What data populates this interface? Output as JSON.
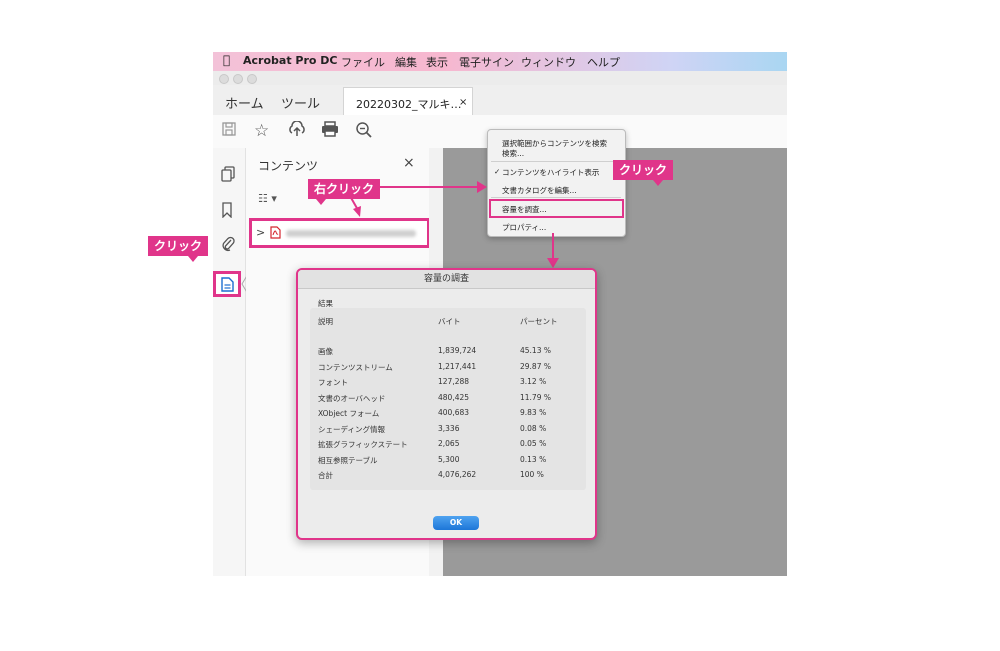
{
  "menubar": {
    "apple": "",
    "app": "Acrobat Pro DC",
    "items": [
      "ファイル",
      "編集",
      "表示",
      "電子サイン",
      "ウィンドウ",
      "ヘルプ"
    ]
  },
  "tabs": {
    "home": "ホーム",
    "tools": "ツール",
    "document": "20220302_マルキ…",
    "document_close": "×"
  },
  "toolbar": {
    "icons": [
      "save-icon",
      "bookmark-star-icon",
      "upload-cloud-icon",
      "print-icon",
      "zoom-out-icon"
    ]
  },
  "panel": {
    "title": "コンテンツ",
    "close": "×",
    "options": "☷ ▾",
    "row_chevron": ">"
  },
  "context_menu": {
    "items": [
      "選択範囲からコンテンツを検索",
      "検索...",
      "コンテンツをハイライト表示",
      "文書カタログを編集...",
      "容量を調査...",
      "プロパティ..."
    ],
    "check": "✓"
  },
  "callouts": {
    "right_click": "右クリック",
    "click_rail": "クリック",
    "click_menu": "クリック"
  },
  "dialog": {
    "title": "容量の調査",
    "result_label": "結果",
    "headers": [
      "説明",
      "バイト",
      "パーセント"
    ],
    "rows": [
      [
        "画像",
        "1,839,724",
        "45.13 %"
      ],
      [
        "コンテンツストリーム",
        "1,217,441",
        "29.87 %"
      ],
      [
        "フォント",
        "127,288",
        "3.12 %"
      ],
      [
        "文書のオーバヘッド",
        "480,425",
        "11.79 %"
      ],
      [
        "XObject フォーム",
        "400,683",
        "9.83 %"
      ],
      [
        "シェーディング情報",
        "3,336",
        "0.08 %"
      ],
      [
        "拡張グラフィックステート",
        "2,065",
        "0.05 %"
      ],
      [
        "相互参照テーブル",
        "5,300",
        "0.13 %"
      ],
      [
        "合計",
        "4,076,262",
        "100 %"
      ]
    ],
    "ok_label": "OK"
  },
  "colors": {
    "accent": "#e0358a",
    "doc_area": "#9a9a9a",
    "ok_button": "#1d76d8"
  }
}
